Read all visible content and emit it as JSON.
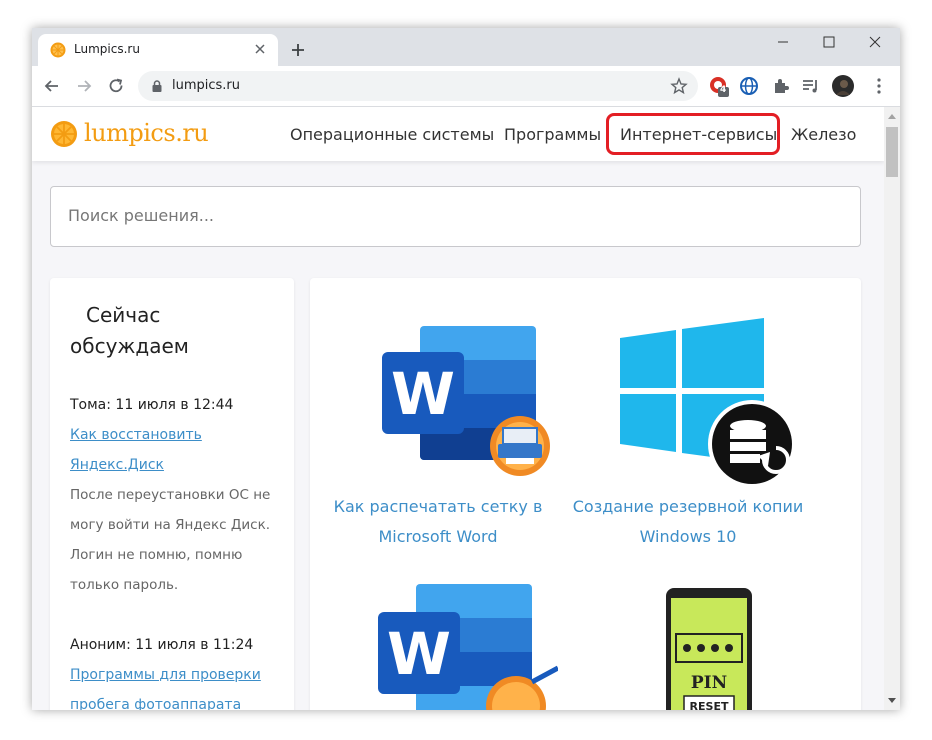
{
  "browser": {
    "tab_title": "Lumpics.ru",
    "url": "lumpics.ru",
    "extension_badge": "4"
  },
  "site": {
    "logo": "lumpics.ru",
    "nav": [
      {
        "label": "Операционные системы"
      },
      {
        "label": "Программы"
      },
      {
        "label": "Интернет-сервисы"
      },
      {
        "label": "Железо"
      }
    ],
    "search_placeholder": "Поиск решения..."
  },
  "sidebar": {
    "title": "Сейчас обсуждаем",
    "comments": [
      {
        "author": "Тома: 11 июля в 12:44",
        "link": "Как восстановить Яндекс.Диск",
        "text": "После переустановки ОС не могу войти на Яндекс Диск. Логин не помню, помню только пароль."
      },
      {
        "author": "Аноним: 11 июля в 11:24",
        "link": "Программы для проверки пробега фотоаппарата",
        "text": ""
      }
    ]
  },
  "articles": [
    {
      "title": "Как распечатать сетку в Microsoft Word",
      "icon": "word-print-icon"
    },
    {
      "title": "Создание резервной копии Windows 10",
      "icon": "windows-backup-icon"
    },
    {
      "title": "",
      "icon": "word-edit-icon"
    },
    {
      "title": "",
      "icon": "phone-pin-reset-icon",
      "image_text_pin": "PIN",
      "image_text_reset": "RESET"
    }
  ],
  "colors": {
    "brand_orange": "#f39c12",
    "link_blue": "#3d8ec8",
    "highlight_red": "#e31e24"
  }
}
